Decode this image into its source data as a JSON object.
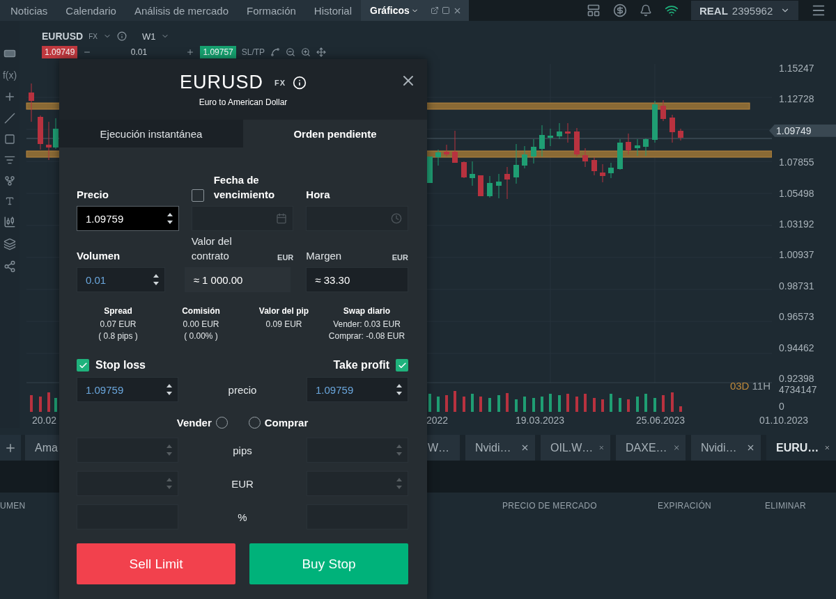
{
  "top_nav": {
    "tabs": [
      {
        "label": "Noticias",
        "selected": false
      },
      {
        "label": "Calendario",
        "selected": false
      },
      {
        "label": "Análisis de mercado",
        "selected": false
      },
      {
        "label": "Formación",
        "selected": false
      },
      {
        "label": "Historial",
        "selected": false
      },
      {
        "label": "Gráficos",
        "selected": true
      }
    ],
    "account": {
      "type": "REAL",
      "number": "2395962"
    }
  },
  "left_toolbar": {
    "function_label": "f(x)"
  },
  "chart": {
    "symbol": "EURUSD",
    "symbol_tag": "FX",
    "timeframe": "W1",
    "sell_price": "1.09749",
    "volume": "0.01",
    "buy_price": "1.09757",
    "sl_tp": "SL/TP",
    "price_axis": [
      "1.15247",
      "1.12728",
      "1.07855",
      "1.05498",
      "1.03192",
      "1.00937",
      "0.98731",
      "0.96573",
      "0.94462",
      "0.92398"
    ],
    "current_price": "1.09749",
    "countdown": {
      "days": "03D",
      "hours": "11H"
    },
    "volume_axis": [
      "4734147",
      "0"
    ],
    "dates": [
      "20.02",
      "2022",
      "19.03.2023",
      "25.06.2023",
      "01.10.2023"
    ]
  },
  "instrument_tabs": [
    {
      "label": "Ama",
      "selected": false
    },
    {
      "label": "W…",
      "selected": false
    },
    {
      "label": "Nvidi…",
      "selected": false
    },
    {
      "label": "OIL.W…",
      "selected": false
    },
    {
      "label": "DAXE…",
      "selected": false
    },
    {
      "label": "Nvidi…",
      "selected": false
    },
    {
      "label": "EURU…",
      "selected": true
    }
  ],
  "orders_table": {
    "columns": [
      "UMEN",
      "PRECIO DE MERCADO",
      "EXPIRACIÓN",
      "ELIMINAR"
    ]
  },
  "order_dialog": {
    "symbol": "EURUSD",
    "symbol_tag": "FX",
    "description": "Euro to American Dollar",
    "tabs": [
      {
        "label": "Ejecución instantánea",
        "selected": false
      },
      {
        "label": "Orden pendiente",
        "selected": true
      }
    ],
    "price": {
      "label": "Precio",
      "value": "1.09759"
    },
    "expiry": {
      "label": "Fecha de vencimiento",
      "checked": false
    },
    "time": {
      "label": "Hora"
    },
    "volume": {
      "label": "Volumen",
      "value": "0.01"
    },
    "contract_value": {
      "label": "Valor del contrato",
      "currency": "EUR",
      "value": "≈ 1 000.00"
    },
    "margin": {
      "label": "Margen",
      "currency": "EUR",
      "value": "≈ 33.30"
    },
    "stats": [
      {
        "title": "Spread",
        "lines": [
          "0.07 EUR",
          "( 0.8 pips )"
        ]
      },
      {
        "title": "Comisión",
        "lines": [
          "0.00 EUR",
          "( 0.00% )"
        ]
      },
      {
        "title": "Valor del pip",
        "lines": [
          "0.09 EUR"
        ]
      },
      {
        "title": "Swap diario",
        "lines": [
          "Vender: 0.03 EUR",
          "Comprar: -0.08 EUR"
        ]
      }
    ],
    "stop_loss": {
      "label": "Stop loss",
      "checked": true,
      "value": "1.09759"
    },
    "take_profit": {
      "label": "Take profit",
      "checked": true,
      "value": "1.09759"
    },
    "price_caption": "precio",
    "direction": [
      {
        "label": "Vender",
        "selected": false
      },
      {
        "label": "Comprar",
        "selected": false
      }
    ],
    "unit_rows": [
      {
        "label": "pips",
        "spinner": true
      },
      {
        "label": "EUR",
        "spinner": true
      },
      {
        "label": "%",
        "spinner": false
      }
    ],
    "buttons": [
      {
        "label": "Sell Limit",
        "kind": "sell"
      },
      {
        "label": "Buy Stop",
        "kind": "buy"
      }
    ]
  }
}
